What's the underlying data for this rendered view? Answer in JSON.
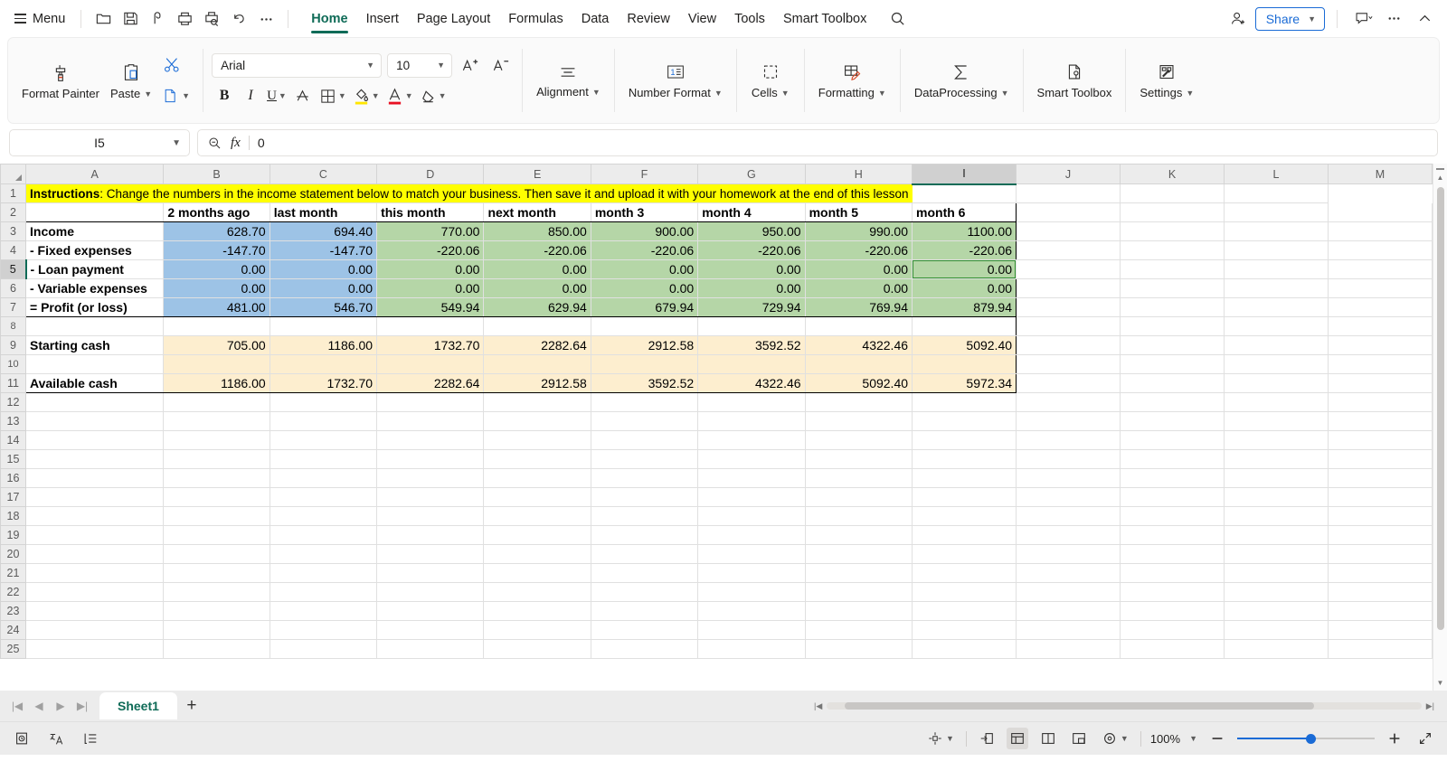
{
  "menubar": {
    "menu_label": "Menu",
    "quick_icons": [
      "open-folder-icon",
      "save-icon",
      "print-preview-icon",
      "print-icon",
      "print-search-icon",
      "undo-icon",
      "more-icon"
    ],
    "tabs": [
      {
        "label": "Home",
        "active": true
      },
      {
        "label": "Insert",
        "active": false
      },
      {
        "label": "Page Layout",
        "active": false
      },
      {
        "label": "Formulas",
        "active": false
      },
      {
        "label": "Data",
        "active": false
      },
      {
        "label": "Review",
        "active": false
      },
      {
        "label": "View",
        "active": false
      },
      {
        "label": "Tools",
        "active": false
      },
      {
        "label": "Smart Toolbox",
        "active": false
      }
    ],
    "share_label": "Share"
  },
  "ribbon": {
    "format_painter_label": "Format Painter",
    "paste_label": "Paste",
    "font_name": "Arial",
    "font_size": "10",
    "alignment_label": "Alignment",
    "number_format_label": "Number Format",
    "cells_label": "Cells",
    "formatting_label": "Formatting",
    "dataprocessing_label": "DataProcessing",
    "smart_toolbox_label": "Smart Toolbox",
    "settings_label": "Settings"
  },
  "formula_bar": {
    "name_box": "I5",
    "formula_value": "0"
  },
  "grid": {
    "columns": [
      "A",
      "B",
      "C",
      "D",
      "E",
      "F",
      "G",
      "H",
      "I",
      "J",
      "K",
      "L",
      "M"
    ],
    "selected_column": "I",
    "selected_row": 5,
    "selected_cell": "I5",
    "rows": [
      1,
      2,
      3,
      4,
      5,
      6,
      7,
      8,
      9,
      10,
      11,
      12,
      13,
      14,
      15,
      16,
      17,
      18,
      19,
      20,
      21,
      22,
      23,
      24,
      25
    ],
    "instructions_bold": "Instructions",
    "instructions_rest": ": Change the numbers in the income statement below to match your business. Then save it and upload it with your homework at the end of this lesson",
    "headers": [
      "2 months ago",
      "last month",
      "this month",
      "next month",
      "month 3",
      "month 4",
      "month 5",
      "month 6"
    ],
    "row_labels": {
      "income": "Income",
      "fixed": "- Fixed expenses",
      "loan": "- Loan payment",
      "variable": "- Variable expenses",
      "profit": "= Profit (or loss)",
      "starting": "Starting cash",
      "available": "Available cash"
    },
    "values": {
      "income": [
        "628.70",
        "694.40",
        "770.00",
        "850.00",
        "900.00",
        "950.00",
        "990.00",
        "1100.00"
      ],
      "fixed": [
        "-147.70",
        "-147.70",
        "-220.06",
        "-220.06",
        "-220.06",
        "-220.06",
        "-220.06",
        "-220.06"
      ],
      "loan": [
        "0.00",
        "0.00",
        "0.00",
        "0.00",
        "0.00",
        "0.00",
        "0.00",
        "0.00"
      ],
      "variable": [
        "0.00",
        "0.00",
        "0.00",
        "0.00",
        "0.00",
        "0.00",
        "0.00",
        "0.00"
      ],
      "profit": [
        "481.00",
        "546.70",
        "549.94",
        "629.94",
        "679.94",
        "729.94",
        "769.94",
        "879.94"
      ],
      "starting": [
        "705.00",
        "1186.00",
        "1732.70",
        "2282.64",
        "2912.58",
        "3592.52",
        "4322.46",
        "5092.40"
      ],
      "available": [
        "1186.00",
        "1732.70",
        "2282.64",
        "2912.58",
        "3592.52",
        "4322.46",
        "5092.40",
        "5972.34"
      ]
    },
    "colors": {
      "instructions_fill": "#ffff00",
      "past_fill": "#9dc3e6",
      "forecast_fill": "#b5d6a7",
      "cash_fill": "#fdeecf",
      "selection_border": "#2f8f2f"
    }
  },
  "sheet_tabs": {
    "active_sheet": "Sheet1",
    "add_label": "+"
  },
  "status_bar": {
    "zoom_level": "100%",
    "view_icons": [
      "normal-view-icon",
      "page-layout-icon",
      "page-break-icon"
    ],
    "accent_color": "#1a6bd6"
  }
}
